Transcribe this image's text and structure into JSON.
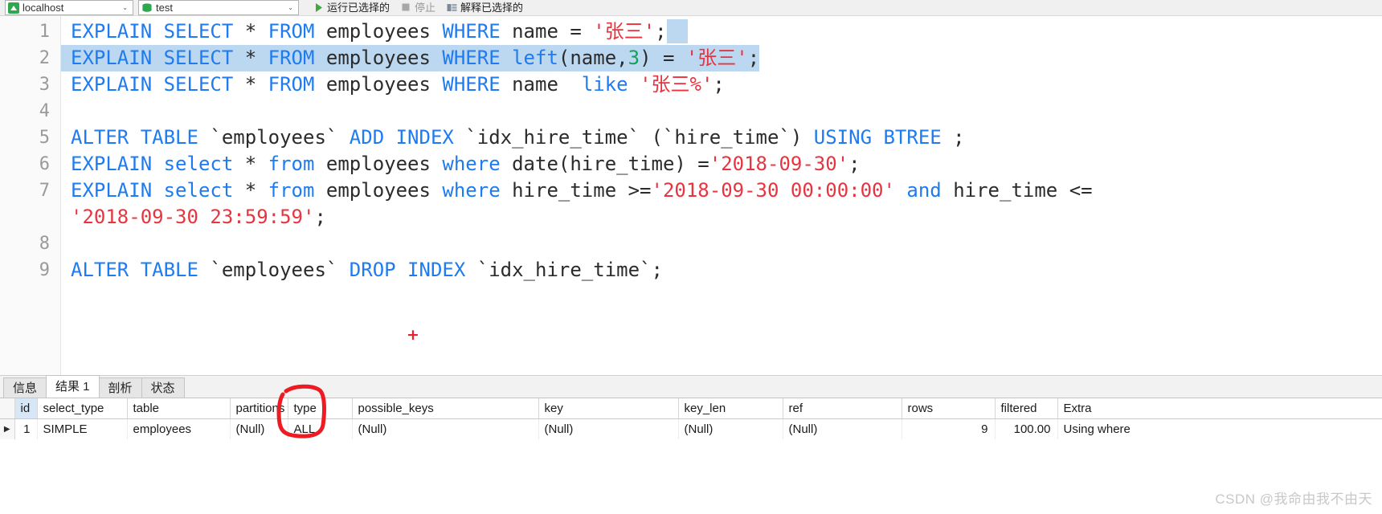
{
  "toolbar": {
    "connection": {
      "label": "localhost",
      "icon": "connection-icon",
      "arrow": "⌄"
    },
    "database": {
      "label": "test",
      "icon": "database-icon",
      "arrow": "⌄"
    },
    "run_selected": {
      "label": "运行已选择的",
      "icon": "play-icon"
    },
    "stop": {
      "label": "停止",
      "icon": "stop-icon"
    },
    "explain_selected": {
      "label": "解释已选择的",
      "icon": "explain-icon"
    }
  },
  "editor": {
    "plus_marker": "+",
    "lines": [
      {
        "num": "1",
        "selected": false,
        "tail_selection": true,
        "tokens": [
          {
            "t": "EXPLAIN SELECT",
            "c": "kw"
          },
          {
            "t": " * ",
            "c": "pl"
          },
          {
            "t": "FROM",
            "c": "kw"
          },
          {
            "t": " employees ",
            "c": "pl"
          },
          {
            "t": "WHERE",
            "c": "kw"
          },
          {
            "t": " name ",
            "c": "pl"
          },
          {
            "t": "= ",
            "c": "pl"
          },
          {
            "t": "'张三'",
            "c": "str"
          },
          {
            "t": ";",
            "c": "pl"
          }
        ]
      },
      {
        "num": "2",
        "selected": true,
        "tail_selection": false,
        "tokens": [
          {
            "t": "EXPLAIN SELECT",
            "c": "kw"
          },
          {
            "t": " * ",
            "c": "pl"
          },
          {
            "t": "FROM",
            "c": "kw"
          },
          {
            "t": " employees ",
            "c": "pl"
          },
          {
            "t": "WHERE",
            "c": "kw"
          },
          {
            "t": " ",
            "c": "pl"
          },
          {
            "t": "left",
            "c": "kw"
          },
          {
            "t": "(name,",
            "c": "pl"
          },
          {
            "t": "3",
            "c": "numlit"
          },
          {
            "t": ") = ",
            "c": "pl"
          },
          {
            "t": "'张三'",
            "c": "str"
          },
          {
            "t": ";",
            "c": "pl"
          }
        ]
      },
      {
        "num": "3",
        "selected": false,
        "tail_selection": false,
        "tokens": [
          {
            "t": "EXPLAIN SELECT",
            "c": "kw"
          },
          {
            "t": " * ",
            "c": "pl"
          },
          {
            "t": "FROM",
            "c": "kw"
          },
          {
            "t": " employees ",
            "c": "pl"
          },
          {
            "t": "WHERE",
            "c": "kw"
          },
          {
            "t": " name  ",
            "c": "pl"
          },
          {
            "t": "like",
            "c": "kw"
          },
          {
            "t": " ",
            "c": "pl"
          },
          {
            "t": "'张三%'",
            "c": "str"
          },
          {
            "t": ";",
            "c": "pl"
          }
        ]
      },
      {
        "num": "4",
        "selected": false,
        "tail_selection": false,
        "tokens": []
      },
      {
        "num": "5",
        "selected": false,
        "tail_selection": false,
        "tokens": [
          {
            "t": "ALTER TABLE",
            "c": "kw"
          },
          {
            "t": " `employees` ",
            "c": "pl"
          },
          {
            "t": "ADD INDEX",
            "c": "kw"
          },
          {
            "t": " `idx_hire_time` (`hire_time`) ",
            "c": "pl"
          },
          {
            "t": "USING BTREE",
            "c": "kw"
          },
          {
            "t": " ;",
            "c": "pl"
          }
        ]
      },
      {
        "num": "6",
        "selected": false,
        "tail_selection": false,
        "tokens": [
          {
            "t": "EXPLAIN select",
            "c": "kw"
          },
          {
            "t": " * ",
            "c": "pl"
          },
          {
            "t": "from",
            "c": "kw"
          },
          {
            "t": " employees ",
            "c": "pl"
          },
          {
            "t": "where",
            "c": "kw"
          },
          {
            "t": " date(hire_time) =",
            "c": "pl"
          },
          {
            "t": "'2018-09-30'",
            "c": "str"
          },
          {
            "t": ";",
            "c": "pl"
          }
        ]
      },
      {
        "num": "7",
        "selected": false,
        "tail_selection": false,
        "tokens": [
          {
            "t": "EXPLAIN select",
            "c": "kw"
          },
          {
            "t": " * ",
            "c": "pl"
          },
          {
            "t": "from",
            "c": "kw"
          },
          {
            "t": " employees ",
            "c": "pl"
          },
          {
            "t": "where",
            "c": "kw"
          },
          {
            "t": " hire_time >=",
            "c": "pl"
          },
          {
            "t": "'2018-09-30 00:00:00'",
            "c": "str"
          },
          {
            "t": " ",
            "c": "pl"
          },
          {
            "t": "and",
            "c": "kw"
          },
          {
            "t": " hire_time <=",
            "c": "pl"
          }
        ]
      },
      {
        "num": "",
        "selected": false,
        "tail_selection": false,
        "tokens": [
          {
            "t": "'2018-09-30 23:59:59'",
            "c": "str"
          },
          {
            "t": ";",
            "c": "pl"
          }
        ]
      },
      {
        "num": "8",
        "selected": false,
        "tail_selection": false,
        "tokens": []
      },
      {
        "num": "9",
        "selected": false,
        "tail_selection": false,
        "tokens": [
          {
            "t": "ALTER TABLE",
            "c": "kw"
          },
          {
            "t": " `employees` ",
            "c": "pl"
          },
          {
            "t": "DROP INDEX",
            "c": "kw"
          },
          {
            "t": " `idx_hire_time`;",
            "c": "pl"
          }
        ]
      }
    ]
  },
  "result_tabs": [
    {
      "label": "信息",
      "active": false
    },
    {
      "label": "结果 1",
      "active": true
    },
    {
      "label": "剖析",
      "active": false
    },
    {
      "label": "状态",
      "active": false
    }
  ],
  "result_grid": {
    "columns": [
      "id",
      "select_type",
      "table",
      "partitions",
      "type",
      "possible_keys",
      "key",
      "key_len",
      "ref",
      "rows",
      "filtered",
      "Extra"
    ],
    "rows": [
      {
        "caret": "▶",
        "cells": [
          {
            "v": "1",
            "null": false,
            "num": true
          },
          {
            "v": "SIMPLE",
            "null": false,
            "num": false
          },
          {
            "v": "employees",
            "null": false,
            "num": false
          },
          {
            "v": "(Null)",
            "null": true,
            "num": false
          },
          {
            "v": "ALL",
            "null": false,
            "num": false
          },
          {
            "v": "(Null)",
            "null": true,
            "num": false
          },
          {
            "v": "(Null)",
            "null": true,
            "num": false
          },
          {
            "v": "(Null)",
            "null": true,
            "num": false
          },
          {
            "v": "(Null)",
            "null": true,
            "num": false
          },
          {
            "v": "9",
            "null": false,
            "num": true
          },
          {
            "v": "100.00",
            "null": false,
            "num": true
          },
          {
            "v": "Using where",
            "null": false,
            "num": false
          }
        ]
      }
    ]
  },
  "annotation": {
    "name": "red-circle-highlight",
    "color": "#ee1b22",
    "target": "type"
  },
  "watermark": {
    "text": "CSDN @我命由我不由天"
  },
  "colors": {
    "keyword": "#1e7bf0",
    "string": "#e8343f",
    "number": "#13a05a",
    "plain": "#2b2b2b",
    "selection": "#bcd7f0",
    "annotation": "#ee1b22"
  }
}
